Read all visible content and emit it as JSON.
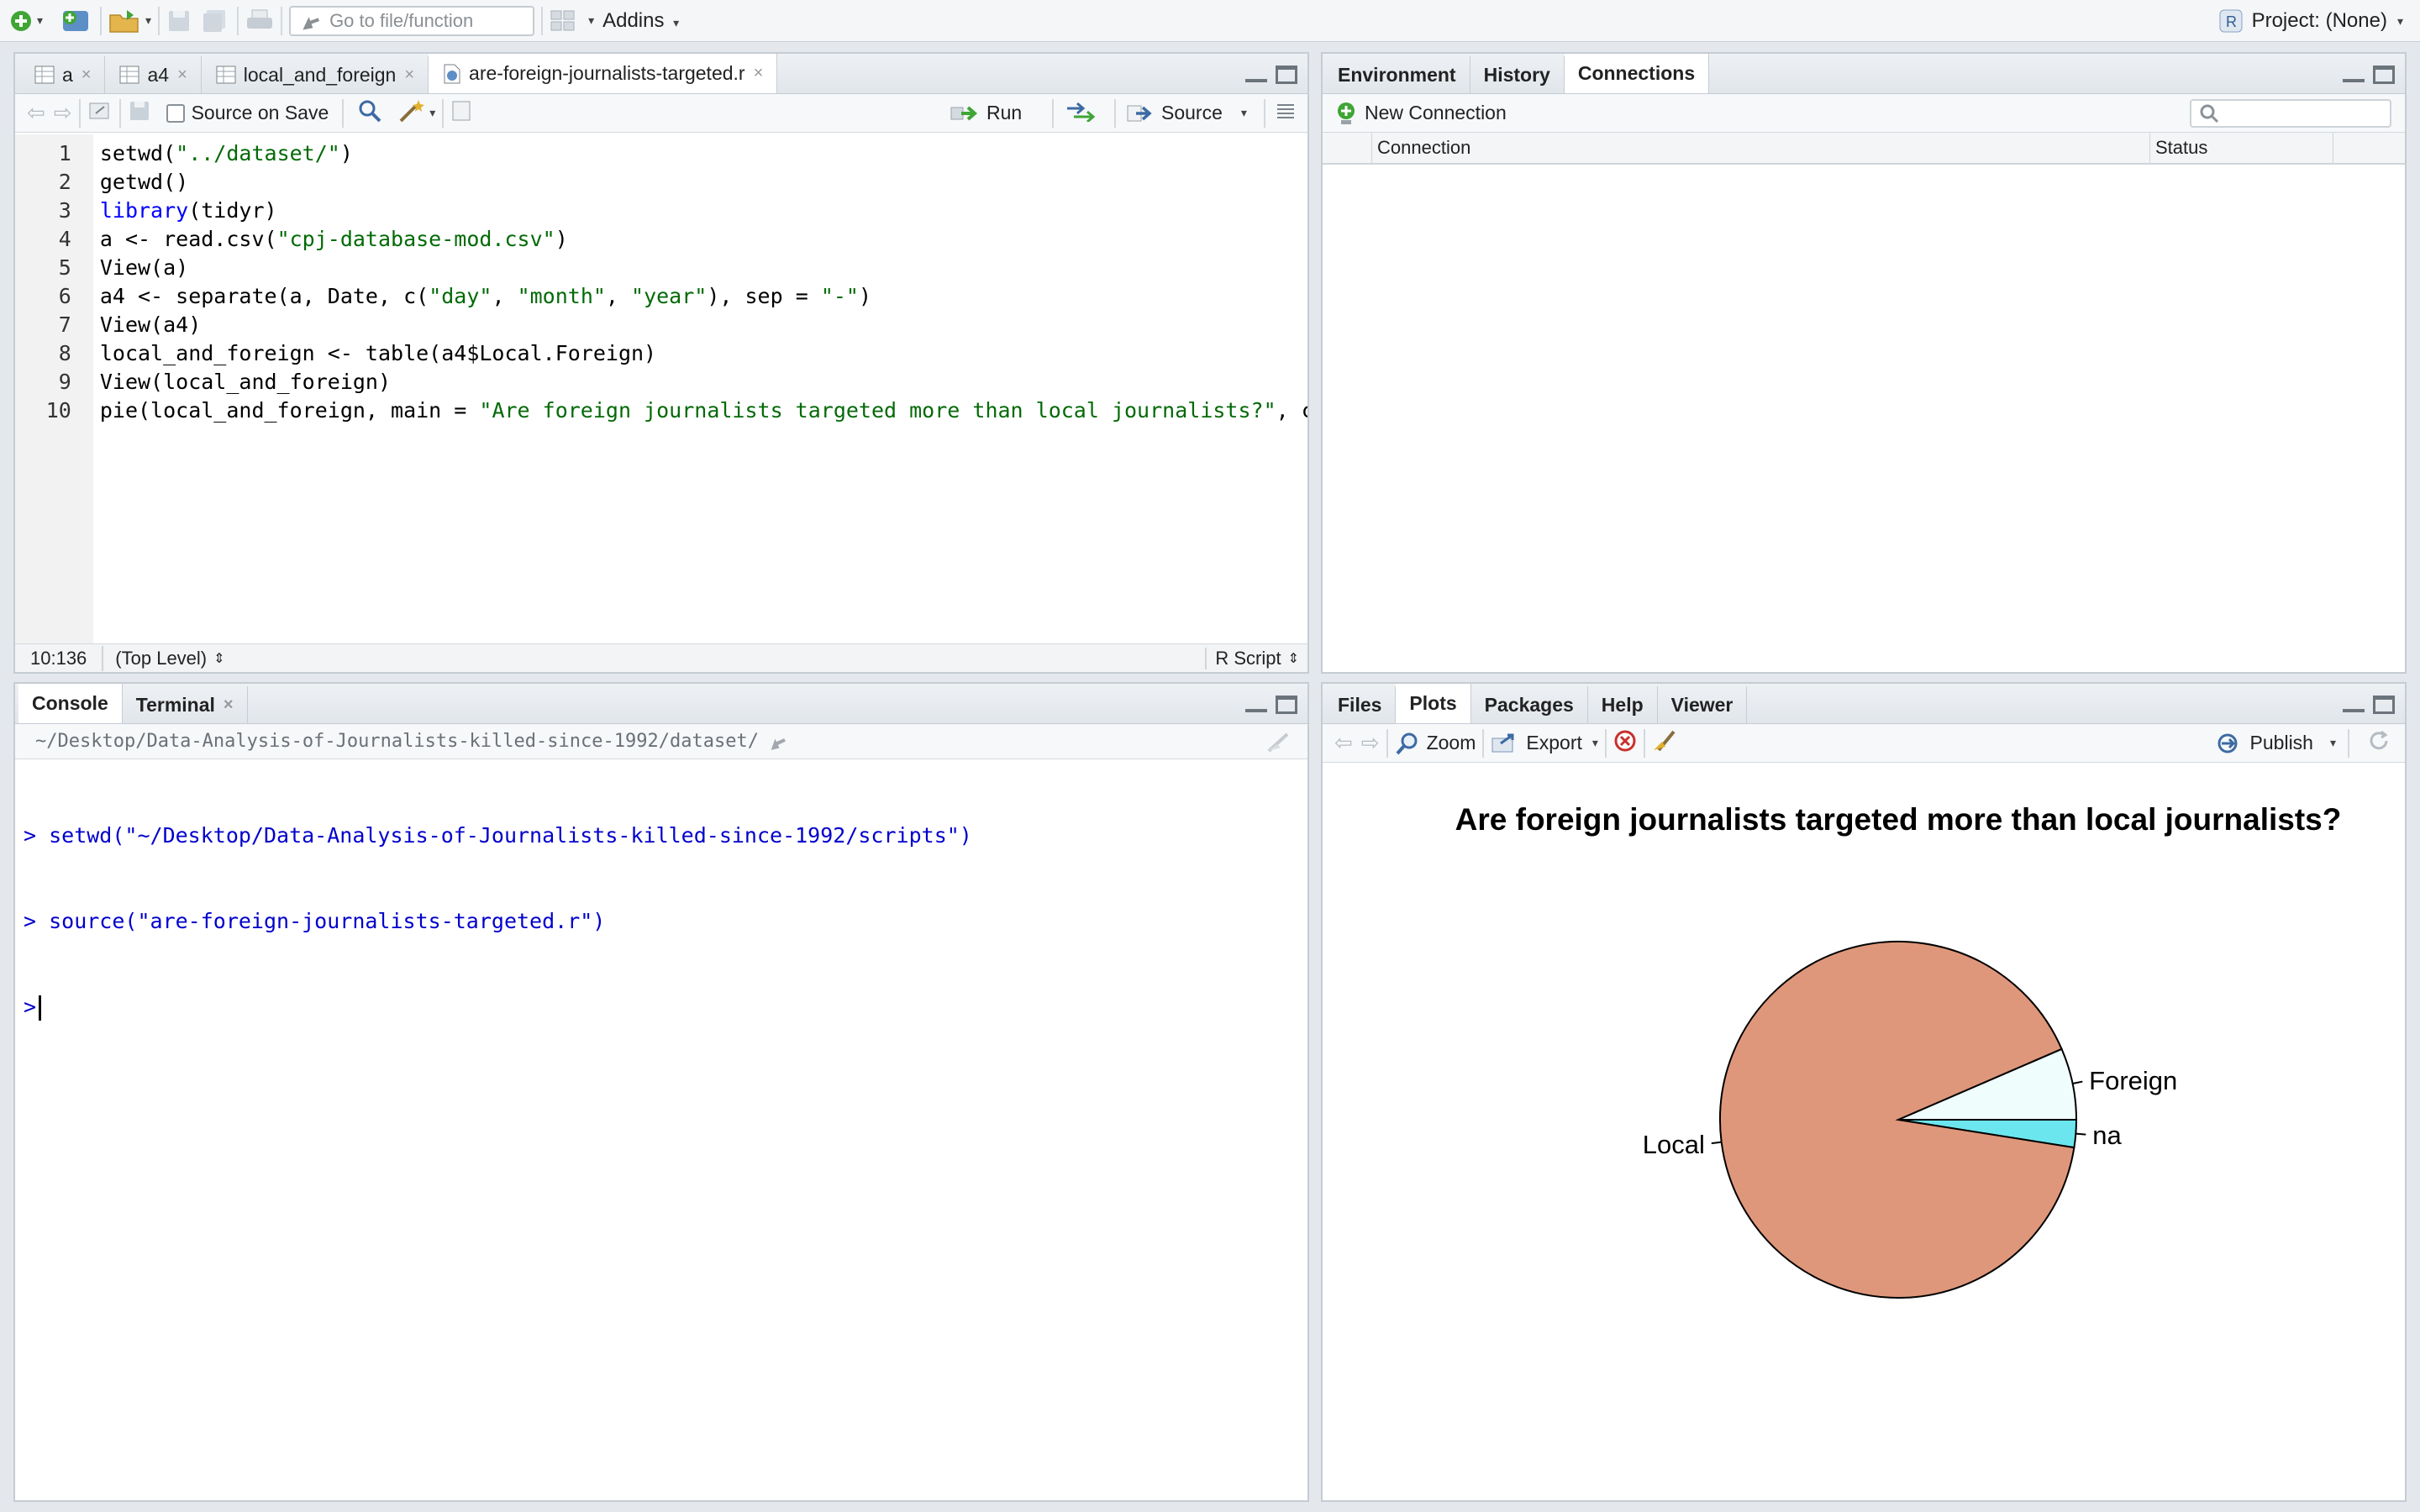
{
  "toolbar": {
    "goto_placeholder": "Go to file/function",
    "addins_label": "Addins",
    "project_label": "Project: (None)"
  },
  "editor": {
    "tabs": [
      {
        "label": "a"
      },
      {
        "label": "a4"
      },
      {
        "label": "local_and_foreign"
      },
      {
        "label": "are-foreign-journalists-targeted.r"
      }
    ],
    "source_on_save_label": "Source on Save",
    "run_label": "Run",
    "source_label": "Source",
    "line_numbers": [
      "1",
      "2",
      "3",
      "4",
      "5",
      "6",
      "7",
      "8",
      "9",
      "10"
    ],
    "cursor_position": "10:136",
    "scope": "(Top Level)",
    "file_type": "R Script"
  },
  "environment": {
    "tabs": [
      {
        "label": "Environment"
      },
      {
        "label": "History"
      },
      {
        "label": "Connections"
      }
    ],
    "new_connection_label": "New Connection",
    "columns": [
      "Connection",
      "Status"
    ]
  },
  "console": {
    "tabs": [
      {
        "label": "Console"
      },
      {
        "label": "Terminal"
      }
    ],
    "path": "~/Desktop/Data-Analysis-of-Journalists-killed-since-1992/dataset/",
    "lines": [
      "> setwd(\"~/Desktop/Data-Analysis-of-Journalists-killed-since-1992/scripts\")",
      "> source(\"are-foreign-journalists-targeted.r\")",
      "> "
    ]
  },
  "files": {
    "tabs": [
      {
        "label": "Files"
      },
      {
        "label": "Plots"
      },
      {
        "label": "Packages"
      },
      {
        "label": "Help"
      },
      {
        "label": "Viewer"
      }
    ],
    "zoom_label": "Zoom",
    "export_label": "Export",
    "publish_label": "Publish"
  },
  "chart_data": {
    "type": "pie",
    "title": "Are foreign journalists targeted more than local journalists?",
    "categories": [
      "Local",
      "Foreign",
      "na"
    ],
    "values": [
      0.91,
      0.065,
      0.025
    ],
    "colors": [
      "#df977b",
      "#f0fdfd",
      "#6ce6ee"
    ]
  }
}
